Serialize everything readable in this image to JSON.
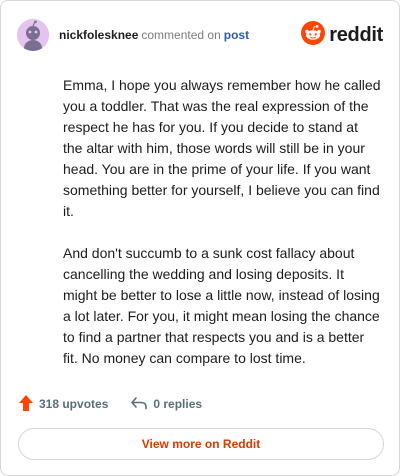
{
  "header": {
    "username": "nickfolesknee",
    "commented_text": "commented on",
    "post_link": "post",
    "brand": "reddit"
  },
  "comment": {
    "paragraphs": [
      "Emma, I hope you always remember how he called you a toddler. That was the real expression of the respect he has for you. If you decide to stand at the altar with him, those words will still be in your head. You are in the prime of your life. If you want something better for yourself, I believe you can find it.",
      "And don't succumb to a sunk cost fallacy about cancelling the wedding and losing deposits. It might be better to lose a little now, instead of losing a lot later. For you, it might mean losing the chance to find a partner that respects you and is a better fit. No money can compare to lost time."
    ]
  },
  "actions": {
    "upvotes": "318 upvotes",
    "replies": "0 replies"
  },
  "footer": {
    "view_more": "View more on Reddit"
  },
  "colors": {
    "brand_orange": "#ff4500",
    "link_blue": "#2a5db0",
    "view_more_text": "#d93a00",
    "avatar_bg": "#e3c4ee"
  },
  "icons": {
    "avatar": "snoo-avatar-icon",
    "brand": "reddit-logo-icon",
    "upvote": "upvote-arrow-icon",
    "reply": "reply-arrow-icon"
  }
}
